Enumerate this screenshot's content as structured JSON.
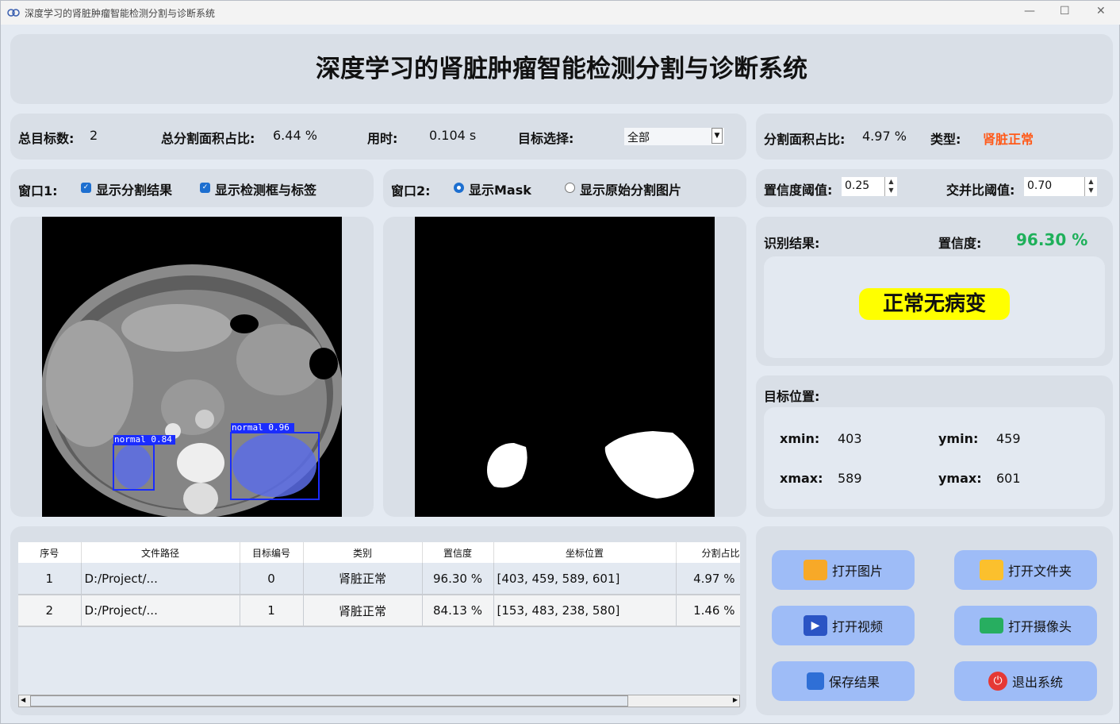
{
  "window": {
    "title": "深度学习的肾脏肿瘤智能检测分割与诊断系统"
  },
  "header": {
    "title": "深度学习的肾脏肿瘤智能检测分割与诊断系统"
  },
  "stats": {
    "total_label": "总目标数:",
    "total_value": "2",
    "area_label": "总分割面积占比:",
    "area_value": "6.44 %",
    "time_label": "用时:",
    "time_value": "0.104 s",
    "target_label": "目标选择:",
    "target_value": "全部"
  },
  "selected": {
    "area_label": "分割面积占比:",
    "area_value": "4.97 %",
    "type_label": "类型:",
    "type_value": "肾脏正常",
    "type_color": "#ff5a1a"
  },
  "window1": {
    "label": "窗口1:",
    "opt1": "显示分割结果",
    "opt2": "显示检测框与标签"
  },
  "window2": {
    "label": "窗口2:",
    "opt1": "显示Mask",
    "opt2": "显示原始分割图片"
  },
  "thresholds": {
    "conf_label": "置信度阈值:",
    "conf_value": "0.25",
    "iou_label": "交并比阈值:",
    "iou_value": "0.70"
  },
  "detections": [
    {
      "label": "normal  0.84"
    },
    {
      "label": "normal  0.96"
    }
  ],
  "result": {
    "label": "识别结果:",
    "conf_label": "置信度:",
    "conf_value": "96.30 %",
    "diagnosis": "正常无病变"
  },
  "position": {
    "label": "目标位置:",
    "xmin_label": "xmin:",
    "xmin": "403",
    "ymin_label": "ymin:",
    "ymin": "459",
    "xmax_label": "xmax:",
    "xmax": "589",
    "ymax_label": "ymax:",
    "ymax": "601"
  },
  "table": {
    "headers": [
      "序号",
      "文件路径",
      "目标编号",
      "类别",
      "置信度",
      "坐标位置",
      "分割占比"
    ],
    "rows": [
      [
        "1",
        "D:/Project/...",
        "0",
        "肾脏正常",
        "96.30 %",
        "[403, 459, 589, 601]",
        "4.97 %"
      ],
      [
        "2",
        "D:/Project/...",
        "1",
        "肾脏正常",
        "84.13 %",
        "[153, 483, 238, 580]",
        "1.46 %"
      ]
    ]
  },
  "buttons": {
    "open_image": "打开图片",
    "open_folder": "打开文件夹",
    "open_video": "打开视频",
    "open_camera": "打开摄像头",
    "save": "保存结果",
    "exit": "退出系统"
  }
}
